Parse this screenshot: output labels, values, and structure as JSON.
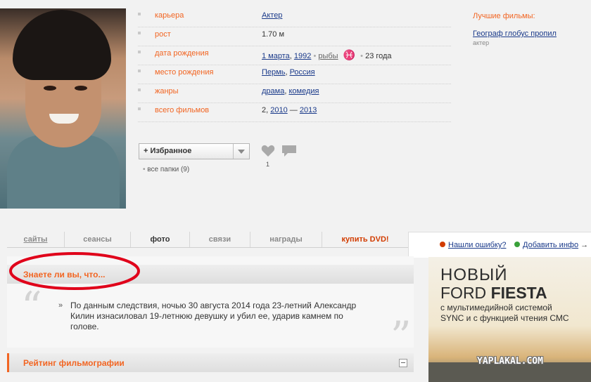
{
  "info": {
    "rows": [
      {
        "label": "карьера",
        "value": "Актер"
      },
      {
        "label": "рост",
        "value": "1.70 м"
      },
      {
        "label": "дата рождения",
        "day": "1 марта",
        "year": "1992",
        "zodiac": "рыбы",
        "zodiac_sign": "♓",
        "age": "23 года"
      },
      {
        "label": "место рождения",
        "city": "Пермь",
        "country": "Россия"
      },
      {
        "label": "жанры",
        "genre1": "драма",
        "genre2": "комедия"
      },
      {
        "label": "всего фильмов",
        "count": "2,",
        "from": "2010",
        "dash": "—",
        "to": "2013"
      }
    ]
  },
  "favorites": {
    "plus": "+",
    "label": "Избранное",
    "all_folders": "все папки (9)",
    "like_count": "1"
  },
  "best_films": {
    "title": "Лучшие фильмы:",
    "film": "Географ глобус пропил",
    "role": "актер"
  },
  "tabs": [
    "сайты",
    "сеансы",
    "фото",
    "связи",
    "награды",
    "купить DVD!"
  ],
  "actions": {
    "report_error": "Нашли ошибку?",
    "add_info": "Добавить инфо",
    "arrow": "→"
  },
  "did_you_know": {
    "title": "Знаете ли вы, что...",
    "text": "По данным следствия, ночью 30 августа 2014 года 23-летний Александр Килин изнасиловал 19-летнюю девушку и убил ее, ударив камнем по голове."
  },
  "rating": {
    "title": "Рейтинг фильмографии"
  },
  "ad": {
    "line1": "НОВЫЙ",
    "line2_a": "FORD ",
    "line2_b": "FIESTA",
    "line3": "с мультимедийной системой",
    "line4": "SYNC и с функцией чтения СМС"
  },
  "watermark": "YAPLAKAL.COM",
  "colors": {
    "accent": "#f26522",
    "link": "#1a3a8a",
    "annotation": "#e0001a"
  }
}
